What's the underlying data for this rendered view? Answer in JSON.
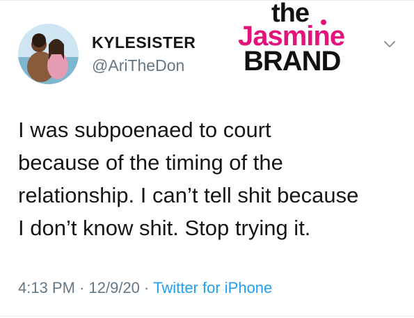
{
  "tweet": {
    "display_name": "KYLESISTER",
    "handle": "@AriTheDon",
    "text_lines": [
      "I was subpoenaed to court",
      "because of the timing of the",
      "relationship. I can’t tell shit because",
      "I don’t know shit. Stop trying it."
    ],
    "time": "4:13 PM",
    "separator": "·",
    "date": "12/9/20",
    "source": "Twitter for iPhone"
  },
  "watermark": {
    "line1": "the",
    "line2": "Jasmine",
    "line3": "BRAND"
  },
  "icons": {
    "more": "chevron-down-icon"
  },
  "colors": {
    "text": "#14171a",
    "secondary": "#657786",
    "link": "#1da1f2",
    "watermark_pink": "#e4137c"
  }
}
